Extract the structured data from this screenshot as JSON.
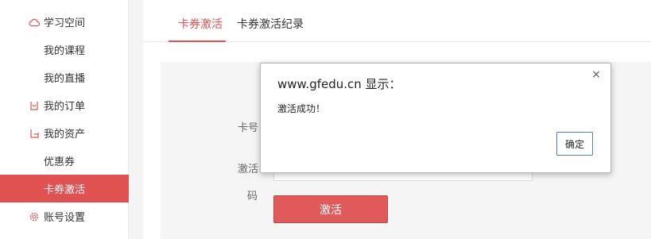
{
  "sidebar": {
    "items": [
      {
        "label": "学习空间",
        "icon": "cloud-icon"
      },
      {
        "label": "我的课程"
      },
      {
        "label": "我的直播"
      },
      {
        "label": "我的订单",
        "icon": "order-icon"
      },
      {
        "label": "我的资产",
        "icon": "wallet-icon"
      },
      {
        "label": "优惠券"
      },
      {
        "label": "卡券激活",
        "active": true
      },
      {
        "label": "账号设置",
        "icon": "gear-icon"
      }
    ]
  },
  "tabs": [
    {
      "label": "卡券激活",
      "active": true
    },
    {
      "label": "卡券激活纪录"
    }
  ],
  "form": {
    "card_label": "卡号",
    "code_label_1": "激活",
    "code_label_2": "码",
    "activate_button": "激活"
  },
  "dialog": {
    "title": "www.gfedu.cn 显示：",
    "message": "激活成功！",
    "ok_button": "确定",
    "close_glyph": "×"
  },
  "colors": {
    "accent": "#e05252",
    "dialog_button_border": "#4a7fc0"
  }
}
